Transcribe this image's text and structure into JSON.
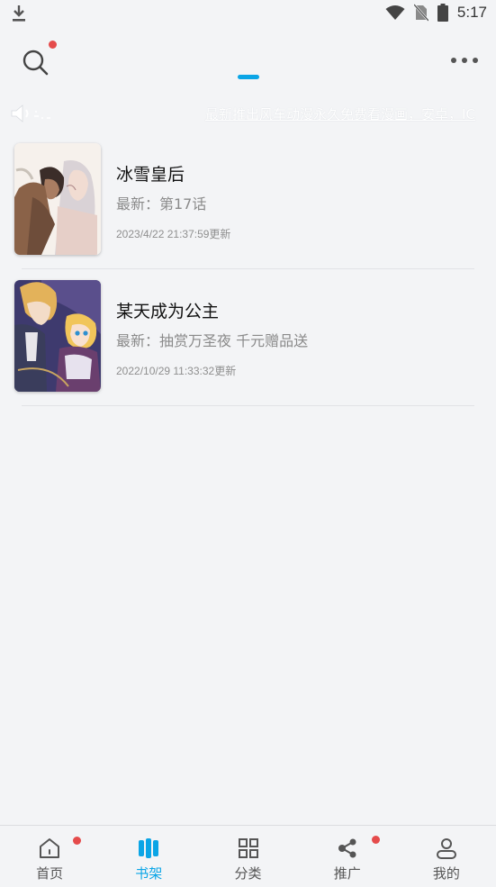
{
  "status_bar": {
    "time": "5:17"
  },
  "header": {
    "notice_text": "最新推出风车动漫永久免费看漫画，安卓，IC"
  },
  "books": [
    {
      "title": "冰雪皇后",
      "latest": "最新：第17话",
      "updated": "2023/4/22 21:37:59更新"
    },
    {
      "title": "某天成为公主",
      "latest": "最新：抽赏万圣夜 千元赠品送",
      "updated": "2022/10/29 11:33:32更新"
    }
  ],
  "bottom_nav": [
    {
      "label": "首页",
      "icon": "home-icon",
      "badge": true,
      "active": false
    },
    {
      "label": "书架",
      "icon": "bookshelf-icon",
      "badge": false,
      "active": true
    },
    {
      "label": "分类",
      "icon": "category-grid-icon",
      "badge": false,
      "active": false
    },
    {
      "label": "推广",
      "icon": "share-icon",
      "badge": true,
      "active": false
    },
    {
      "label": "我的",
      "icon": "profile-icon",
      "badge": false,
      "active": false
    }
  ],
  "colors": {
    "accent": "#0aa5e6",
    "badge": "#e54b4b",
    "background": "#f3f4f6"
  }
}
